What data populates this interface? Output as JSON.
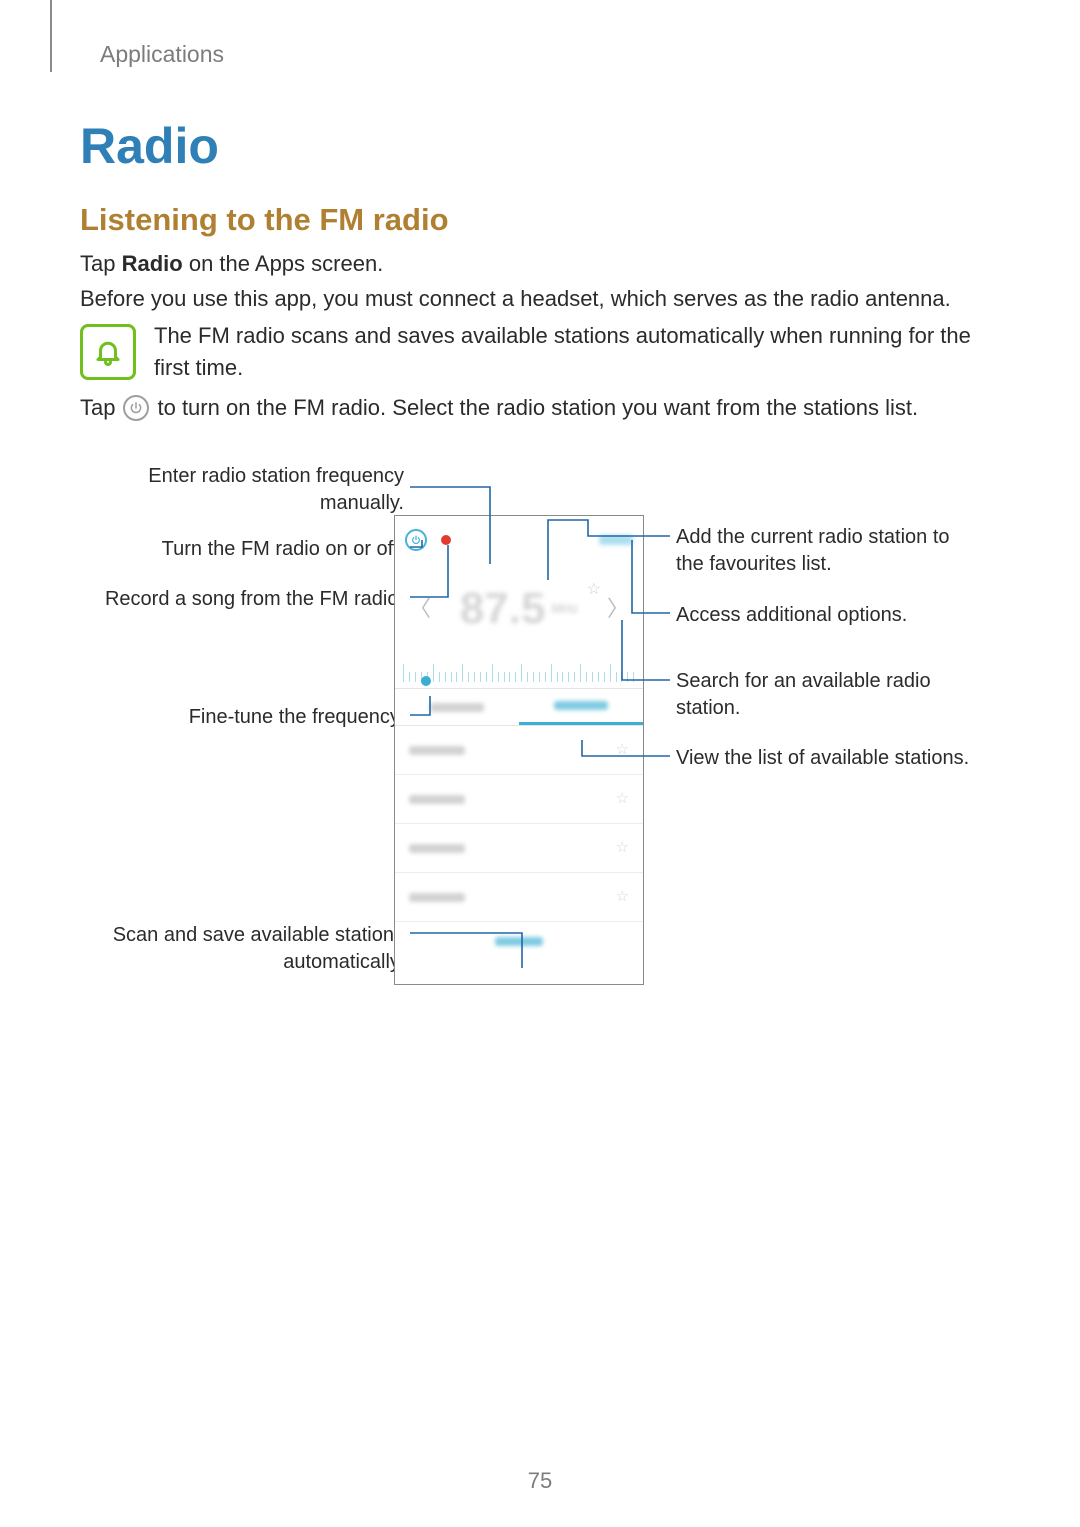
{
  "breadcrumb": "Applications",
  "page_title": "Radio",
  "section_title": "Listening to the FM radio",
  "para1_pre": "Tap ",
  "para1_bold": "Radio",
  "para1_post": " on the Apps screen.",
  "para2": "Before you use this app, you must connect a headset, which serves as the radio antenna.",
  "note_text": "The FM radio scans and saves available stations automatically when running for the first time.",
  "para3_pre": "Tap ",
  "para3_post": " to turn on the FM radio. Select the radio station you want from the stations list.",
  "callouts": {
    "left": {
      "enter_freq": "Enter radio station frequency manually.",
      "toggle_radio": "Turn the FM radio on or off.",
      "record": "Record a song from the FM radio.",
      "fine_tune": "Fine-tune the frequency.",
      "scan_save": "Scan and save available stations automatically."
    },
    "right": {
      "add_fav": "Add the current radio station to the favourites list.",
      "more_options": "Access additional options.",
      "search_station": "Search for an available radio station.",
      "view_list": "View the list of available stations."
    }
  },
  "phone": {
    "frequency_value": "87.5",
    "frequency_unit": "MHz"
  },
  "page_number": "75"
}
